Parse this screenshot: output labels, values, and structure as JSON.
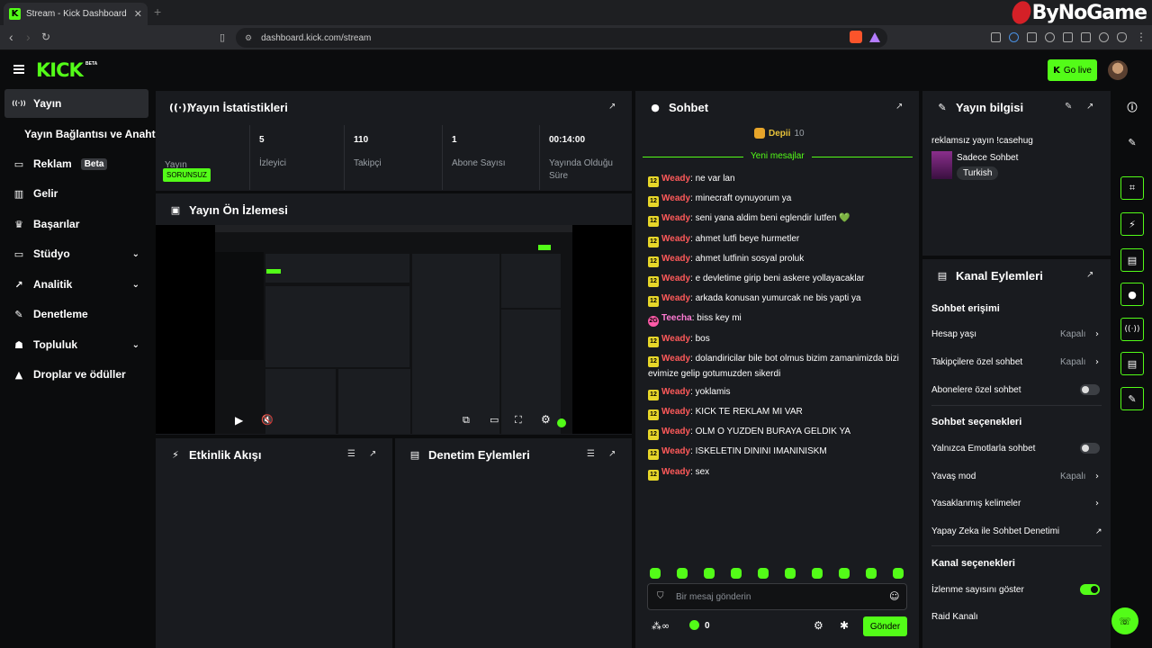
{
  "browser": {
    "tab_title": "Stream - Kick Dashboard",
    "url": "dashboard.kick.com/stream",
    "watermark": "ByNoGame"
  },
  "header": {
    "logo": "KICK",
    "logo_badge": "BETA",
    "go_live": "Go live"
  },
  "sidebar": {
    "items": [
      {
        "label": "Yayın",
        "icon": "broadcast-icon",
        "active": true
      },
      {
        "label": "Yayın Bağlantısı ve Anahtarı",
        "icon": ""
      },
      {
        "label": "Reklam",
        "icon": "ad-icon",
        "badge": "Beta"
      },
      {
        "label": "Gelir",
        "icon": "chart-icon"
      },
      {
        "label": "Başarılar",
        "icon": "trophy-icon"
      },
      {
        "label": "Stüdyo",
        "icon": "studio-icon",
        "expand": true
      },
      {
        "label": "Analitik",
        "icon": "analytics-icon",
        "expand": true
      },
      {
        "label": "Denetleme",
        "icon": "wrench-icon"
      },
      {
        "label": "Topluluk",
        "icon": "community-icon",
        "expand": true
      },
      {
        "label": "Droplar ve ödüller",
        "icon": "drops-icon"
      }
    ]
  },
  "stats": {
    "title": "Yayın İstatistikleri",
    "status": "SORUNSUZ",
    "items": [
      {
        "value": "",
        "label": "Yayın"
      },
      {
        "value": "5",
        "label": "İzleyici"
      },
      {
        "value": "110",
        "label": "Takipçi"
      },
      {
        "value": "1",
        "label": "Abone Sayısı"
      },
      {
        "value": "00:14:00",
        "label": "Yayında Olduğu Süre"
      }
    ]
  },
  "preview": {
    "title": "Yayın Ön İzlemesi"
  },
  "activity": {
    "title": "Etkinlik Akışı"
  },
  "moderation": {
    "title": "Denetim Eylemleri"
  },
  "chat": {
    "title": "Sohbet",
    "pinned_user": "Depii",
    "pinned_count": "10",
    "new_messages": "Yeni mesajlar",
    "messages": [
      {
        "badge": "12",
        "user": "Weady",
        "text": ": ne var lan"
      },
      {
        "badge": "12",
        "user": "Weady",
        "text": ": minecraft oynuyorum ya"
      },
      {
        "badge": "12",
        "user": "Weady",
        "text": ": seni yana aldim beni eglendir lutfen 💚"
      },
      {
        "badge": "12",
        "user": "Weady",
        "text": ": ahmet lutfi beye hurmetler"
      },
      {
        "badge": "12",
        "user": "Weady",
        "text": ": ahmet lutfinin sosyal proluk"
      },
      {
        "badge": "12",
        "user": "Weady",
        "text": ": e devletime girip beni askere yollayacaklar"
      },
      {
        "badge": "12",
        "user": "Weady",
        "text": ": arkada konusan yumurcak ne bis yapti ya"
      },
      {
        "badge": "2G",
        "user": "Teecha",
        "text": ": biss key mi"
      },
      {
        "badge": "12",
        "user": "Weady",
        "text": ": bos"
      },
      {
        "badge": "12",
        "user": "Weady",
        "text": ": dolandiricilar bile bot olmus bizim zamanimizda bizi evimize gelip gotumuzden sikerdi"
      },
      {
        "badge": "12",
        "user": "Weady",
        "text": ": yoklamis"
      },
      {
        "badge": "12",
        "user": "Weady",
        "text": ": KICK TE REKLAM MI VAR"
      },
      {
        "badge": "12",
        "user": "Weady",
        "text": ": OLM O YUZDEN BURAYA GELDIK YA"
      },
      {
        "badge": "12",
        "user": "Weady",
        "text": ": ISKELETIN DININI IMANINISKM"
      },
      {
        "badge": "12",
        "user": "Weady",
        "text": ": sex"
      }
    ],
    "input_placeholder": "Bir mesaj gönderin",
    "send": "Gönder",
    "viewer_count": "0"
  },
  "stream_info": {
    "title": "Yayın bilgisi",
    "stream_title": "reklamsız yayın !casehug",
    "category": "Sadece Sohbet",
    "tag": "Turkish"
  },
  "channel_actions": {
    "title": "Kanal Eylemleri",
    "chat_access": "Sohbet erişimi",
    "account_age": "Hesap yaşı",
    "account_age_value": "Kapalı",
    "followers_only": "Takipçilere özel sohbet",
    "followers_only_value": "Kapalı",
    "subs_only": "Abonelere özel sohbet",
    "chat_options": "Sohbet seçenekleri",
    "emote_only": "Yalnızca Emotlarla sohbet",
    "slow_mode": "Yavaş mod",
    "slow_mode_value": "Kapalı",
    "banned_words": "Yasaklanmış kelimeler",
    "ai_mod": "Yapay Zeka ile Sohbet Denetimi",
    "channel_options": "Kanal seçenekleri",
    "show_viewers": "İzlenme sayısını göster",
    "raid": "Raid Kanalı",
    "toggles": {
      "subs_only": false,
      "emote_only": false,
      "show_viewers": true
    }
  },
  "colors": {
    "accent": "#53fc18",
    "panel": "#191b1f",
    "bg": "#0b0c0d",
    "username": "#ff5a5a"
  }
}
